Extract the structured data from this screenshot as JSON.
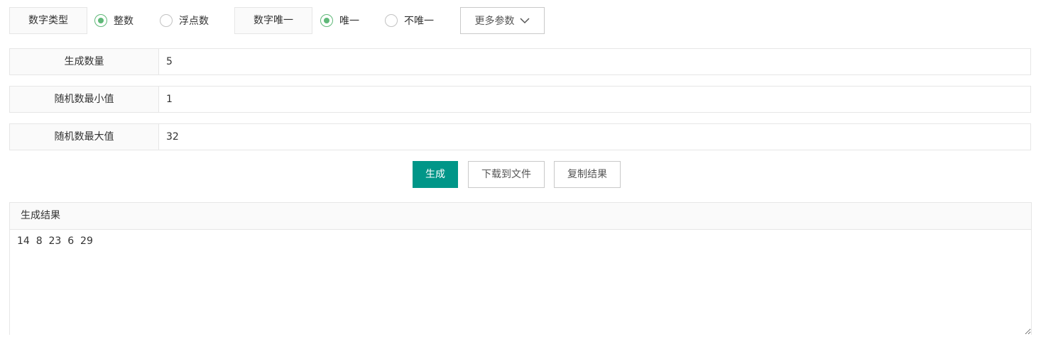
{
  "options": {
    "number_type_label": "数字类型",
    "number_type_choices": [
      {
        "label": "整数",
        "selected": true
      },
      {
        "label": "浮点数",
        "selected": false
      }
    ],
    "unique_label": "数字唯一",
    "unique_choices": [
      {
        "label": "唯一",
        "selected": true
      },
      {
        "label": "不唯一",
        "selected": false
      }
    ],
    "more_params_label": "更多参数",
    "more_params_icon": "chevron-down-icon"
  },
  "form": {
    "count_label": "生成数量",
    "count_value": "5",
    "min_label": "随机数最小值",
    "min_value": "1",
    "max_label": "随机数最大值",
    "max_value": "32"
  },
  "actions": {
    "generate_label": "生成",
    "download_label": "下载到文件",
    "copy_label": "复制结果"
  },
  "result": {
    "title": "生成结果",
    "text": "14  8  23  6  29"
  },
  "colors": {
    "primary": "#009688",
    "radio_checked": "#5fb878",
    "border": "#e6e6e6",
    "label_bg": "#fafafa"
  }
}
